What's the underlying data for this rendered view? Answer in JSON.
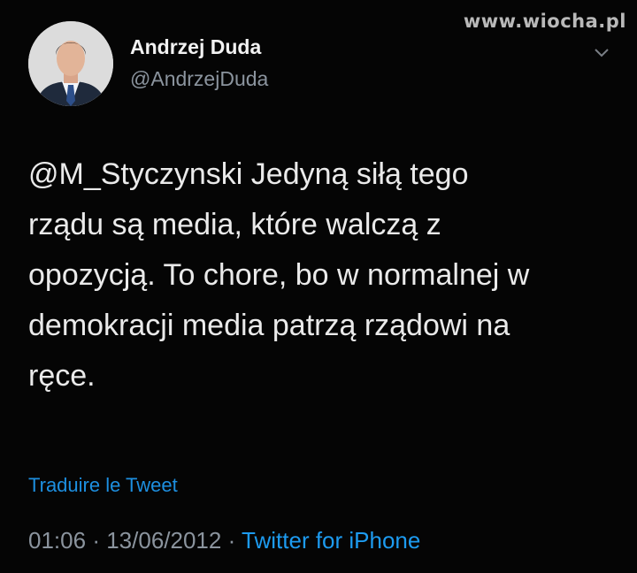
{
  "watermark": "www.wiocha.pl",
  "author": {
    "name": "Andrzej Duda",
    "handle": "@AndrzejDuda"
  },
  "tweet": {
    "text": "@M_Styczynski Jedyną siłą tego\nrządu są media, które walczą z\nopozycją. To chore, bo w normalnej w\ndemokracji media patrzą rządowi na\nręce.",
    "translate_label": "Traduire le Tweet",
    "time": "01:06",
    "separator": "·",
    "date": "13/06/2012",
    "source": "Twitter for iPhone"
  },
  "colors": {
    "background": "#050505",
    "link": "#1d9bf0",
    "muted": "#8b949e"
  },
  "icons": {
    "menu": "chevron-down-icon"
  }
}
